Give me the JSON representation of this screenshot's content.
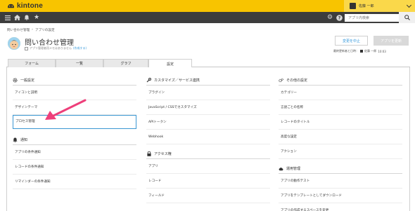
{
  "header": {
    "logo_text": "kintone",
    "user_name": "佐藤 一郎"
  },
  "nav": {
    "search_placeholder": "アプリ内検索"
  },
  "breadcrumb": [
    "問い合わせ管理",
    "›",
    "アプリの設定"
  ],
  "app": {
    "title": "問い合わせ管理",
    "note": "アプリ管理者用メモはありません",
    "note_link": "(作成する)"
  },
  "actions": {
    "cancel_label": "変更を中止",
    "update_label": "アプリを更新"
  },
  "meta": {
    "label": "最終更新者と日時：",
    "user": "佐藤 一郎",
    "time": "10:03"
  },
  "tabs": [
    {
      "label": "フォーム"
    },
    {
      "label": "一覧"
    },
    {
      "label": "グラフ"
    },
    {
      "label": "設定",
      "active": true
    }
  ],
  "columns": [
    {
      "sections": [
        {
          "title": "一般設定",
          "icon": "gear-icon",
          "items": [
            "アイコンと説明",
            "デザインテーマ",
            "プロセス管理"
          ]
        },
        {
          "title": "通知",
          "icon": "bell-icon",
          "items": [
            "アプリの条件通知",
            "レコードの条件通知",
            "リマインダーの条件通知"
          ]
        }
      ]
    },
    {
      "sections": [
        {
          "title": "カスタマイズ／サービス連携",
          "icon": "wrench-icon",
          "items": [
            "プラグイン",
            "JavaScript / CSSでカスタマイズ",
            "APIトークン",
            "Webhook"
          ]
        },
        {
          "title": "アクセス権",
          "icon": "lock-icon",
          "items": [
            "アプリ",
            "レコード",
            "フィールド"
          ]
        }
      ]
    },
    {
      "sections": [
        {
          "title": "その他の設定",
          "icon": "gears-icon",
          "items": [
            "カテゴリー",
            "言語ごとの名称",
            "レコードのタイトル",
            "高度な設定",
            "アクション"
          ]
        },
        {
          "title": "運用管理",
          "icon": "cloud-icon",
          "items": [
            "アプリの動作テスト",
            "アプリをテンプレートとしてダウンロード",
            "アプリの作成するスペースを変更"
          ]
        }
      ]
    }
  ],
  "colors": {
    "header_yellow": "#f8c400",
    "nav_dark": "#3d3d3d",
    "link_blue": "#3498db",
    "arrow_pink": "#ee3f7a"
  }
}
